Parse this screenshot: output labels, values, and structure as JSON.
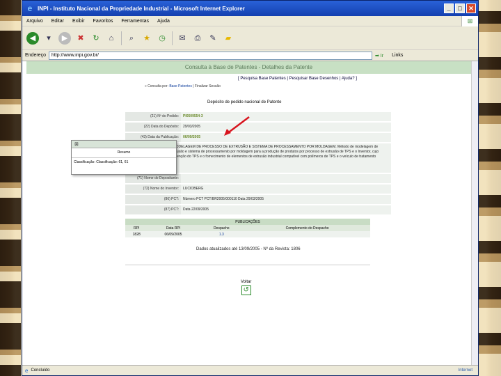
{
  "window": {
    "title": "INPI - Instituto Nacional da Propriedade Industrial - Microsoft Internet Explorer",
    "min": "_",
    "max": "□",
    "close": "✕"
  },
  "menu": [
    "Arquivo",
    "Editar",
    "Exibir",
    "Favoritos",
    "Ferramentas",
    "Ajuda"
  ],
  "address": {
    "label": "Endereço",
    "value": "http://www.inpi.gov.br/",
    "go": "Ir",
    "links": "Links"
  },
  "page": {
    "header": "Consulta à Base de Patentes - Detalhes da Patente",
    "nav": "[ Pesquisa Base Patentes | Pesquisar Base Desenhos | Ajuda? ]",
    "breadcrumb_prefix": "» Consulta por:",
    "breadcrumb_link": "Base Patentes",
    "breadcrumb_suffix": "| Finalizar Sessão",
    "section_title": "Depósito de pedido nacional de Patente",
    "rows": [
      {
        "label": "(21) Nº do Pedido:",
        "value": "PI0509554-3",
        "green": true
      },
      {
        "label": "(22) Data do Depósito:",
        "value": "29/03/2005"
      },
      {
        "label": "(43) Data da Publicação:",
        "value": "06/09/2005",
        "green": true
      },
      {
        "label": "(51) Classificação:",
        "value": "MÉTODO DE MODELAGEM DE PROCESSO DE EXTRUSÃO E SISTEMA DE PROCESSAMENTO POR MOLDAGEM. Método de modelagem de processo de extrusão e sistema de processamento por moldagem para a produção de produtos por processo de extrusão de TPS e o Inventor, cujo propósito é a obtenção do TPS e o fornecimento de elementos de extrusão industrial compatível com polímeros de TPS e o veículo de tratamento contínuo.",
        "tall": true
      },
      {
        "label": "(71) Nome do Depositante:",
        "value": ""
      },
      {
        "label": "(72) Nome do Inventor:",
        "value": "LUCIOBERG"
      },
      {
        "label": "(86) PCT:",
        "value": "Número PCT PCT/BR2005/000110 Data 29/03/2005"
      },
      {
        "label": "(87) PCT:",
        "value": "Data 22/09/2005"
      }
    ],
    "tooltip": {
      "head": "⊠",
      "title": "Resumo",
      "row": "Classificação: Classificação: 61, 61"
    },
    "publications": {
      "title": "PUBLICAÇÕES",
      "headers": [
        "RPI",
        "Data RPI",
        "Despacho",
        "Complemento do Despacho"
      ],
      "rows": [
        {
          "rpi": "1828",
          "date": "06/09/2005",
          "despacho": "1.3",
          "complemento": ""
        }
      ]
    },
    "consult_note": "Dados atualizados até 13/09/2005 - Nº da Revista: 1806",
    "voltar": "Voltar"
  },
  "status": {
    "text": "Concluído",
    "zone": "Internet"
  }
}
